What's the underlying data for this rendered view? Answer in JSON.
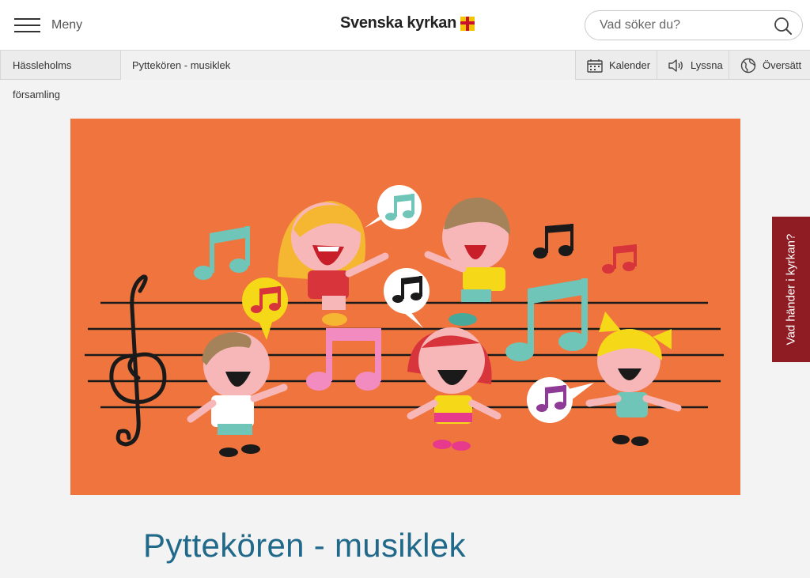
{
  "header": {
    "menu_label": "Meny",
    "logo_text": "Svenska kyrkan",
    "search_placeholder": "Vad söker du?"
  },
  "breadcrumb": {
    "parish": "Hässleholms församling",
    "current": "Pyttekören - musiklek"
  },
  "toolbar": {
    "calendar_label": "Kalender",
    "listen_label": "Lyssna",
    "translate_label": "Översätt"
  },
  "side_tab": {
    "label": "Vad händer i kyrkan?"
  },
  "page": {
    "title": "Pyttekören - musiklek"
  },
  "colors": {
    "accent_blue": "#20698a",
    "hero_orange": "#ef743d",
    "side_tab_red": "#8f1c22",
    "logo_yellow": "#f2c500",
    "logo_red": "#c8102e"
  },
  "icons": [
    "menu-icon",
    "logo-cross-icon",
    "search-icon",
    "calendar-icon",
    "speaker-icon",
    "globe-icon"
  ]
}
